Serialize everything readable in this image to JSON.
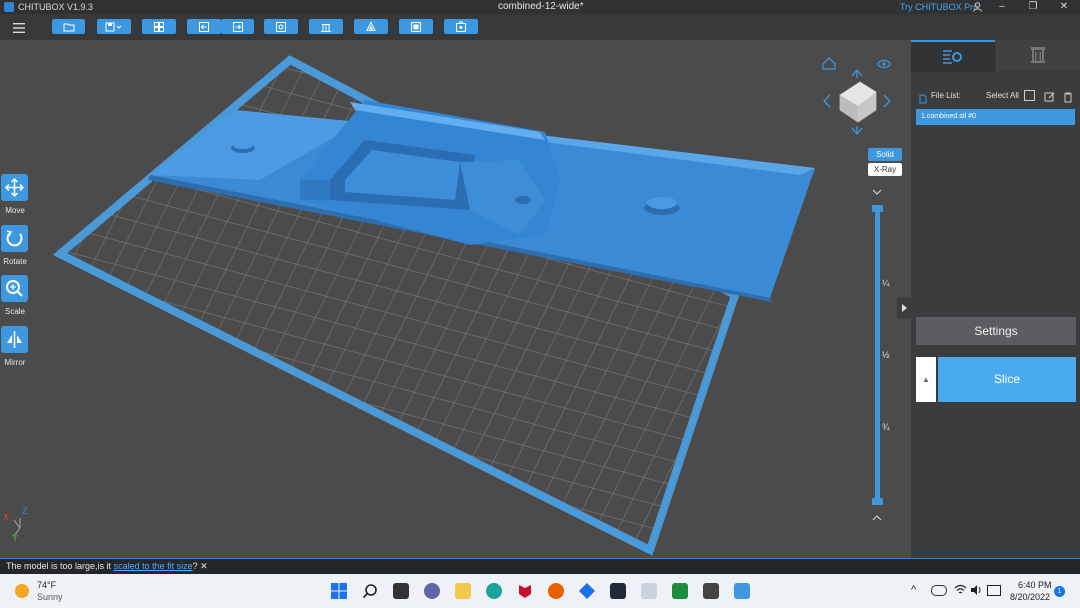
{
  "window": {
    "app_title": "CHITUBOX V1.9.3",
    "document_title": "combined-12-wide*",
    "try_pro": "Try CHITUBOX Pro",
    "minimize": "–",
    "maximize": "❐",
    "close": "✕"
  },
  "toolbar": {
    "buttons": [
      "open-file",
      "save",
      "arrange",
      "import",
      "export",
      "repair",
      "support",
      "hollow",
      "fill",
      "dig-hole"
    ]
  },
  "left_tools": {
    "move": "Move",
    "rotate": "Rotate",
    "scale": "Scale",
    "mirror": "Mirror"
  },
  "view_modes": {
    "solid": "Solid",
    "xray": "X-Ray"
  },
  "layer_slider": {
    "marks": [
      "¼",
      "½",
      "¾"
    ]
  },
  "axis": {
    "x": "X",
    "y": "Y",
    "z": "Z"
  },
  "right_panel": {
    "file_list_label": "File List:",
    "select_all": "Select All",
    "file_item": "1.combined.stl #0",
    "settings": "Settings",
    "slice": "Slice",
    "slice_menu": "▲"
  },
  "status": {
    "message_prefix": "The model is too large,is it ",
    "message_link": "scaled to the fit size",
    "message_suffix": "?",
    "close": "✕"
  },
  "taskbar": {
    "weather_temp": "74°F",
    "weather_desc": "Sunny",
    "time": "6:40 PM",
    "date": "8/20/2022",
    "notification_count": "1",
    "chevron": "^"
  },
  "colors": {
    "accent": "#3d98e0",
    "model": "#3a8ad6",
    "plate_border": "#4b9ad8"
  }
}
